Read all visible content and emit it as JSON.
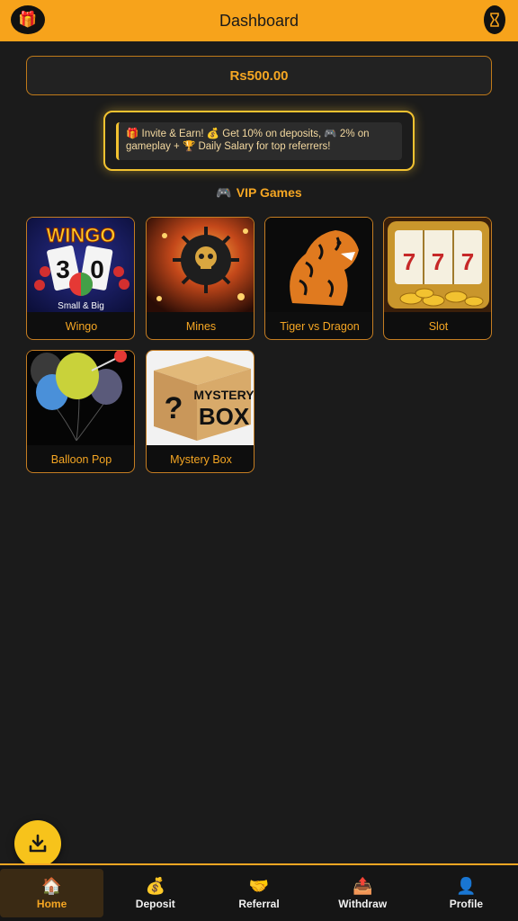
{
  "header": {
    "title": "Dashboard",
    "left_icon": "gift-icon",
    "right_icon": "hourglass-icon"
  },
  "balance": {
    "amount": "Rs500.00"
  },
  "invite": {
    "text": "🎁 Invite & Earn! 💰 Get 10% on deposits, 🎮 2% on gameplay + 🏆 Daily Salary for top referrers!"
  },
  "section": {
    "title": "VIP Games",
    "icon": "gamepad-icon"
  },
  "games": [
    {
      "label": "Wingo",
      "art_text": "WINGO",
      "art_sub": "Small & Big",
      "nums": [
        "3",
        "0"
      ]
    },
    {
      "label": "Mines"
    },
    {
      "label": "Tiger vs Dragon"
    },
    {
      "label": "Slot",
      "reels": [
        "7",
        "7",
        "7"
      ]
    },
    {
      "label": "Balloon Pop"
    },
    {
      "label": "Mystery Box",
      "art_line1": "MYSTERY",
      "art_line2": "BOX"
    }
  ],
  "fab": {
    "icon": "download-icon"
  },
  "nav": [
    {
      "label": "Home",
      "icon": "🏠",
      "active": true
    },
    {
      "label": "Deposit",
      "icon": "💰",
      "active": false
    },
    {
      "label": "Referral",
      "icon": "🤝",
      "active": false
    },
    {
      "label": "Withdraw",
      "icon": "📤",
      "active": false
    },
    {
      "label": "Profile",
      "icon": "👤",
      "active": false
    }
  ],
  "colors": {
    "accent": "#f7a31b",
    "background": "#1b1b1b",
    "border": "#c57d22"
  }
}
